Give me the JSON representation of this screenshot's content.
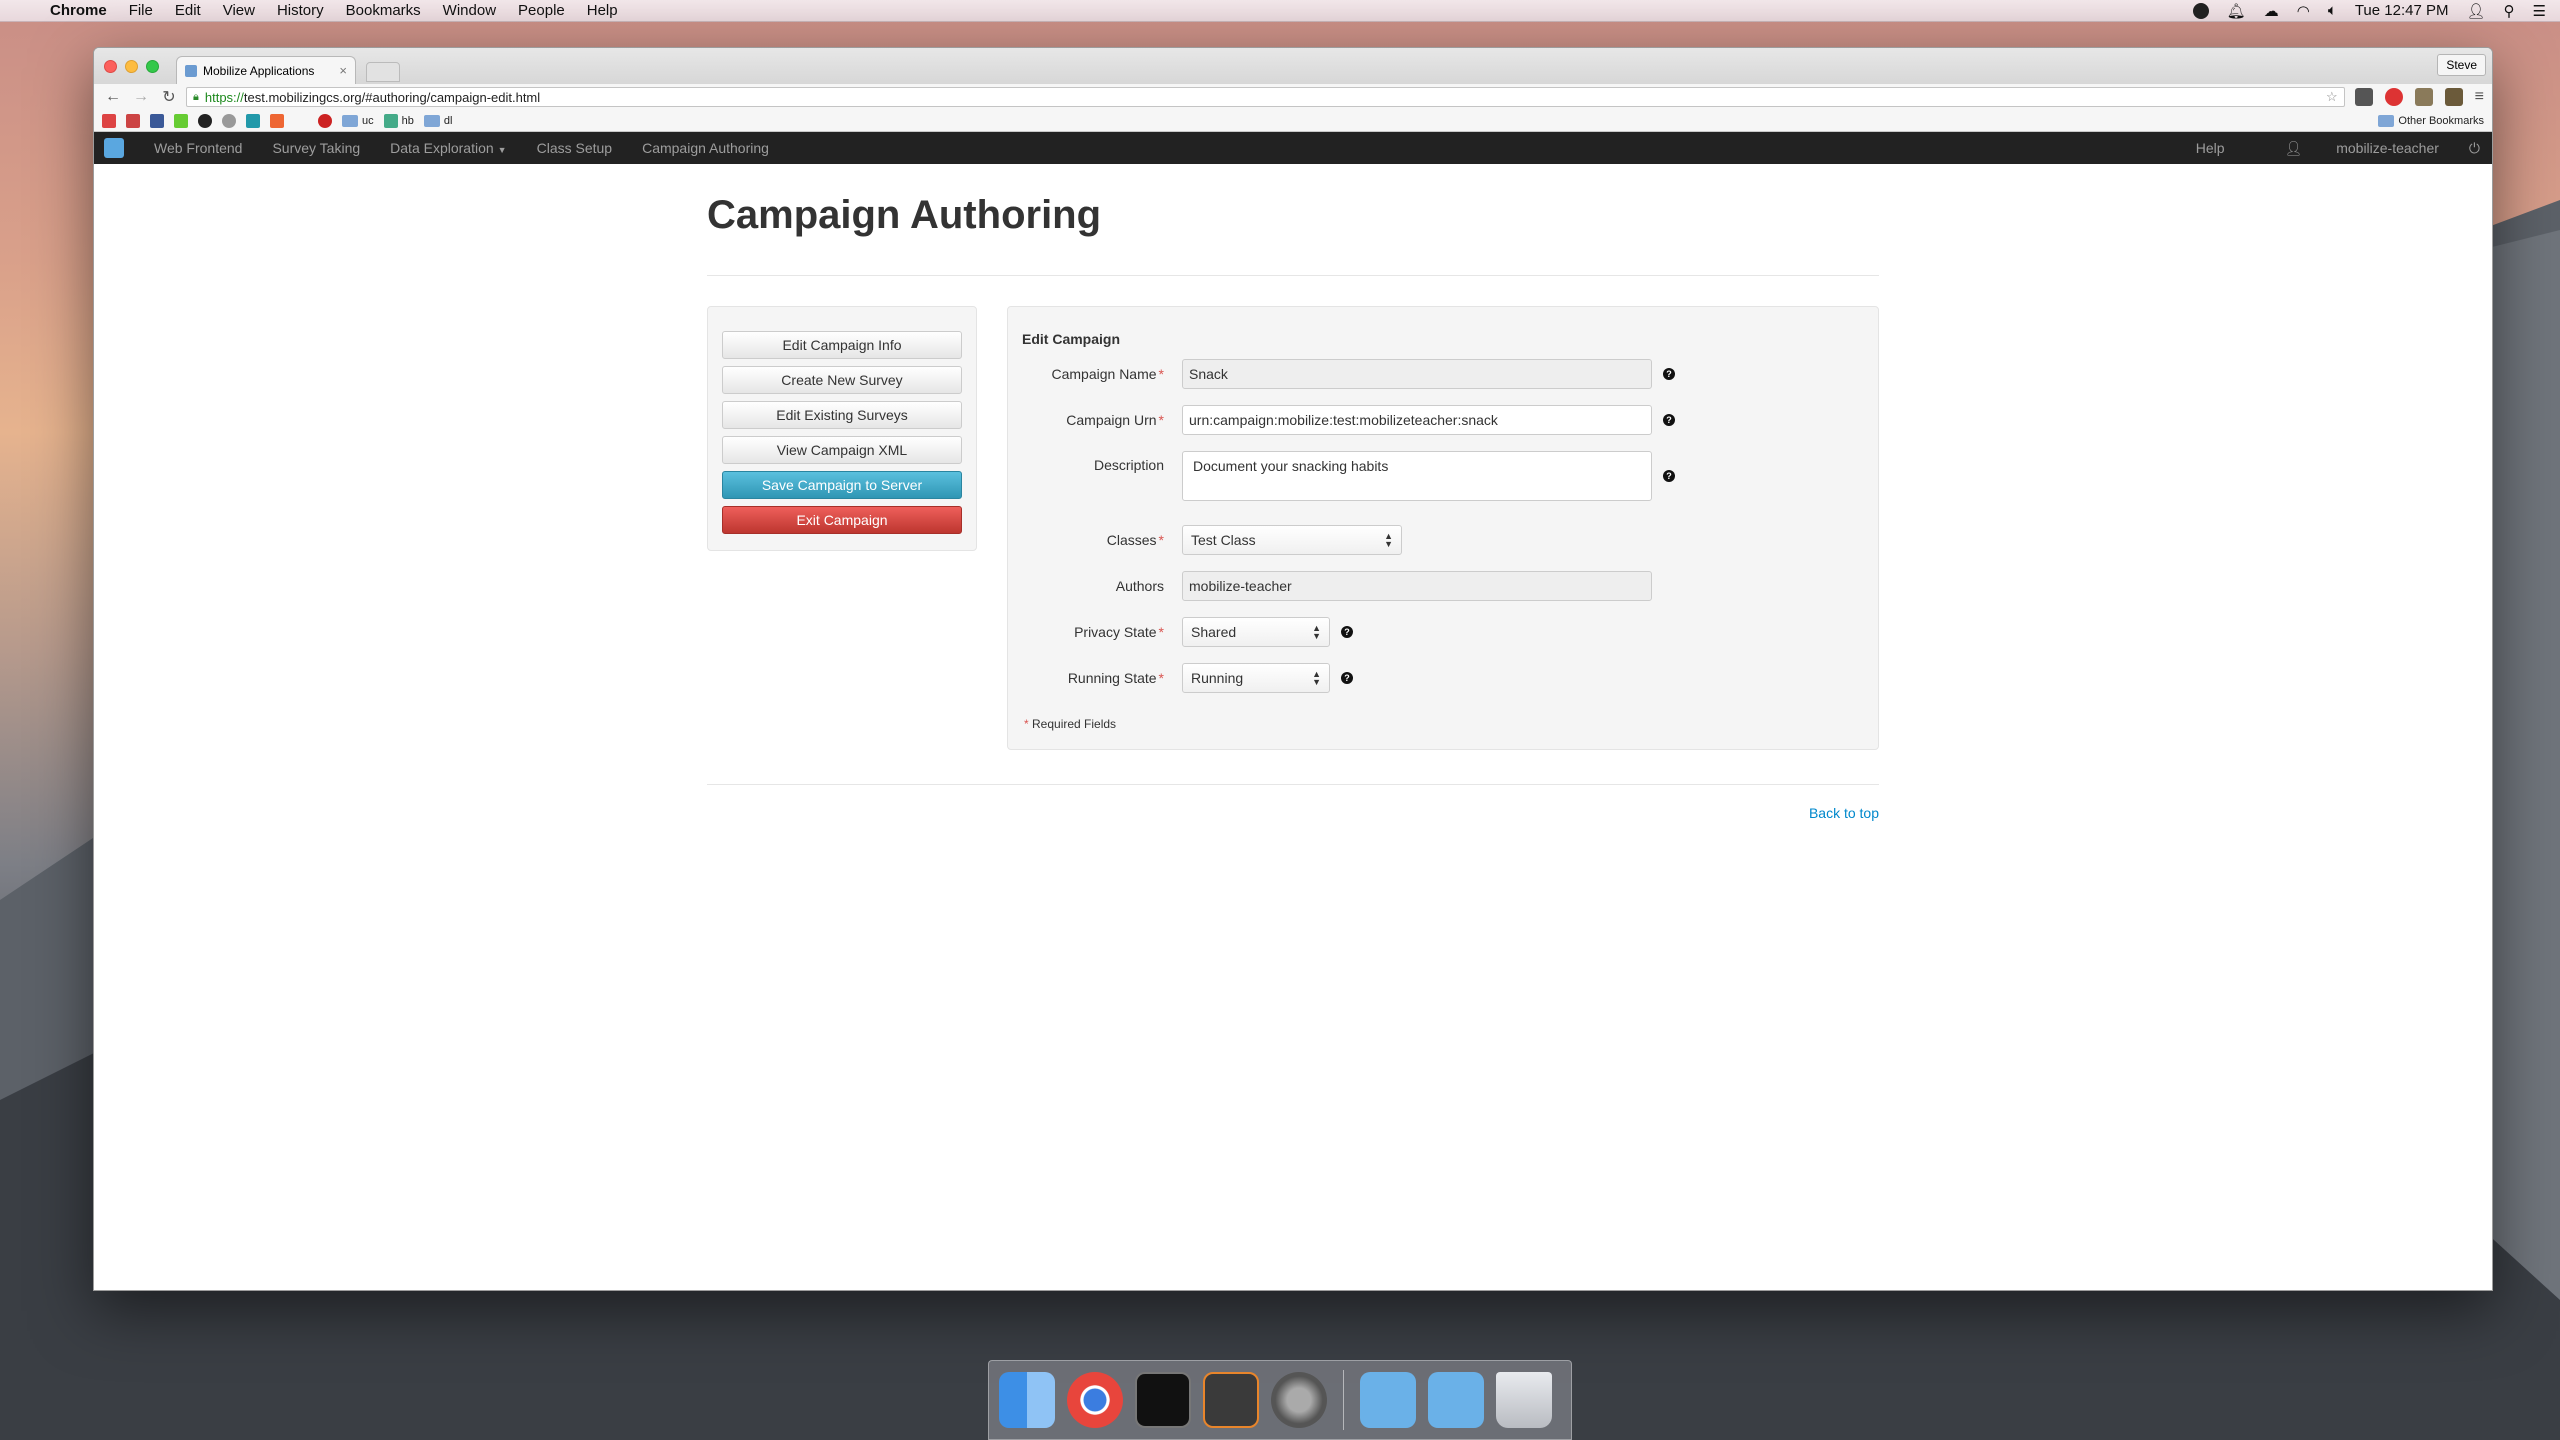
{
  "menubar": {
    "app": "Chrome",
    "items": [
      "File",
      "Edit",
      "View",
      "History",
      "Bookmarks",
      "Window",
      "People",
      "Help"
    ],
    "clock": "Tue 12:47 PM"
  },
  "browser": {
    "tab_title": "Mobilize Applications",
    "profile": "Steve",
    "url_scheme": "https://",
    "url_rest": "test.mobilizingcs.org/#authoring/campaign-edit.html",
    "bookmarks": [
      "uc",
      "hb",
      "dl"
    ],
    "other_bookmarks": "Other Bookmarks"
  },
  "sitenav": {
    "links": [
      "Web Frontend",
      "Survey Taking",
      "Data Exploration",
      "Class Setup",
      "Campaign Authoring"
    ],
    "help": "Help",
    "user": "mobilize-teacher"
  },
  "page": {
    "title": "Campaign Authoring"
  },
  "sidebar": {
    "buttons": [
      "Edit Campaign Info",
      "Create New Survey",
      "Edit Existing Surveys",
      "View Campaign XML",
      "Save Campaign to Server",
      "Exit Campaign"
    ]
  },
  "form": {
    "legend": "Edit Campaign",
    "campaign_name": {
      "label": "Campaign Name",
      "value": "Snack"
    },
    "campaign_urn": {
      "label": "Campaign Urn",
      "value": "urn:campaign:mobilize:test:mobilizeteacher:snack"
    },
    "description": {
      "label": "Description",
      "value": "Document your snacking habits"
    },
    "classes": {
      "label": "Classes",
      "value": "Test Class"
    },
    "authors": {
      "label": "Authors",
      "value": "mobilize-teacher"
    },
    "privacy_state": {
      "label": "Privacy State",
      "value": "Shared"
    },
    "running_state": {
      "label": "Running State",
      "value": "Running"
    },
    "required_note": "Required Fields",
    "required_mark": "*"
  },
  "footer": {
    "back_to_top": "Back to top"
  }
}
